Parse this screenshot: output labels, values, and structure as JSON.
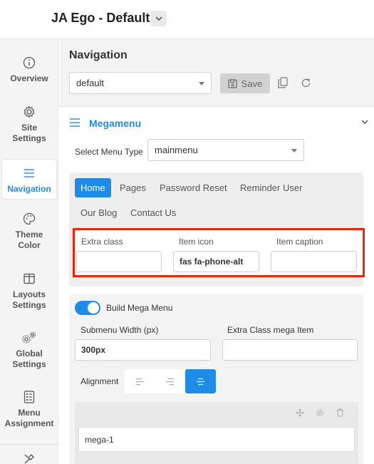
{
  "header": {
    "title": "JA Ego - Default"
  },
  "sidebar": {
    "items": [
      {
        "label": "Overview",
        "icon": "info-icon"
      },
      {
        "label": "Site Settings",
        "icon": "gear-icon"
      },
      {
        "label": "Navigation",
        "icon": "hamburger-icon",
        "active": true
      },
      {
        "label": "Theme Color",
        "icon": "palette-icon"
      },
      {
        "label": "Layouts Settings",
        "icon": "layout-icon"
      },
      {
        "label": "Global Settings",
        "icon": "gears-icon"
      },
      {
        "label": "Menu Assignment",
        "icon": "list-icon"
      },
      {
        "label": "",
        "icon": "tools-icon"
      }
    ]
  },
  "main": {
    "title": "Navigation",
    "preset_select": "default",
    "save_label": "Save",
    "megamenu": {
      "title": "Megamenu",
      "select_menu_type_label": "Select Menu Type",
      "menu_type_value": "mainmenu",
      "tabs": [
        "Home",
        "Pages",
        "Password Reset",
        "Reminder User",
        "Our Blog",
        "Contact Us"
      ],
      "active_tab": "Home",
      "fields": {
        "extra_class_label": "Extra class",
        "extra_class_value": "",
        "item_icon_label": "Item icon",
        "item_icon_value": "fas fa-phone-alt",
        "item_caption_label": "Item caption",
        "item_caption_value": ""
      },
      "build_mega_menu_label": "Build Mega Menu",
      "build_mega_menu_on": true,
      "submenu_width_label": "Submenu Width (px)",
      "submenu_width_value": "300px",
      "extra_class_mega_label": "Extra Class mega Item",
      "extra_class_mega_value": "",
      "alignment_label": "Alignment",
      "alignment_selected": "center",
      "mega_item_name": "mega-1"
    }
  },
  "colors": {
    "accent": "#1e8ce6",
    "highlight": "#e8270f"
  }
}
